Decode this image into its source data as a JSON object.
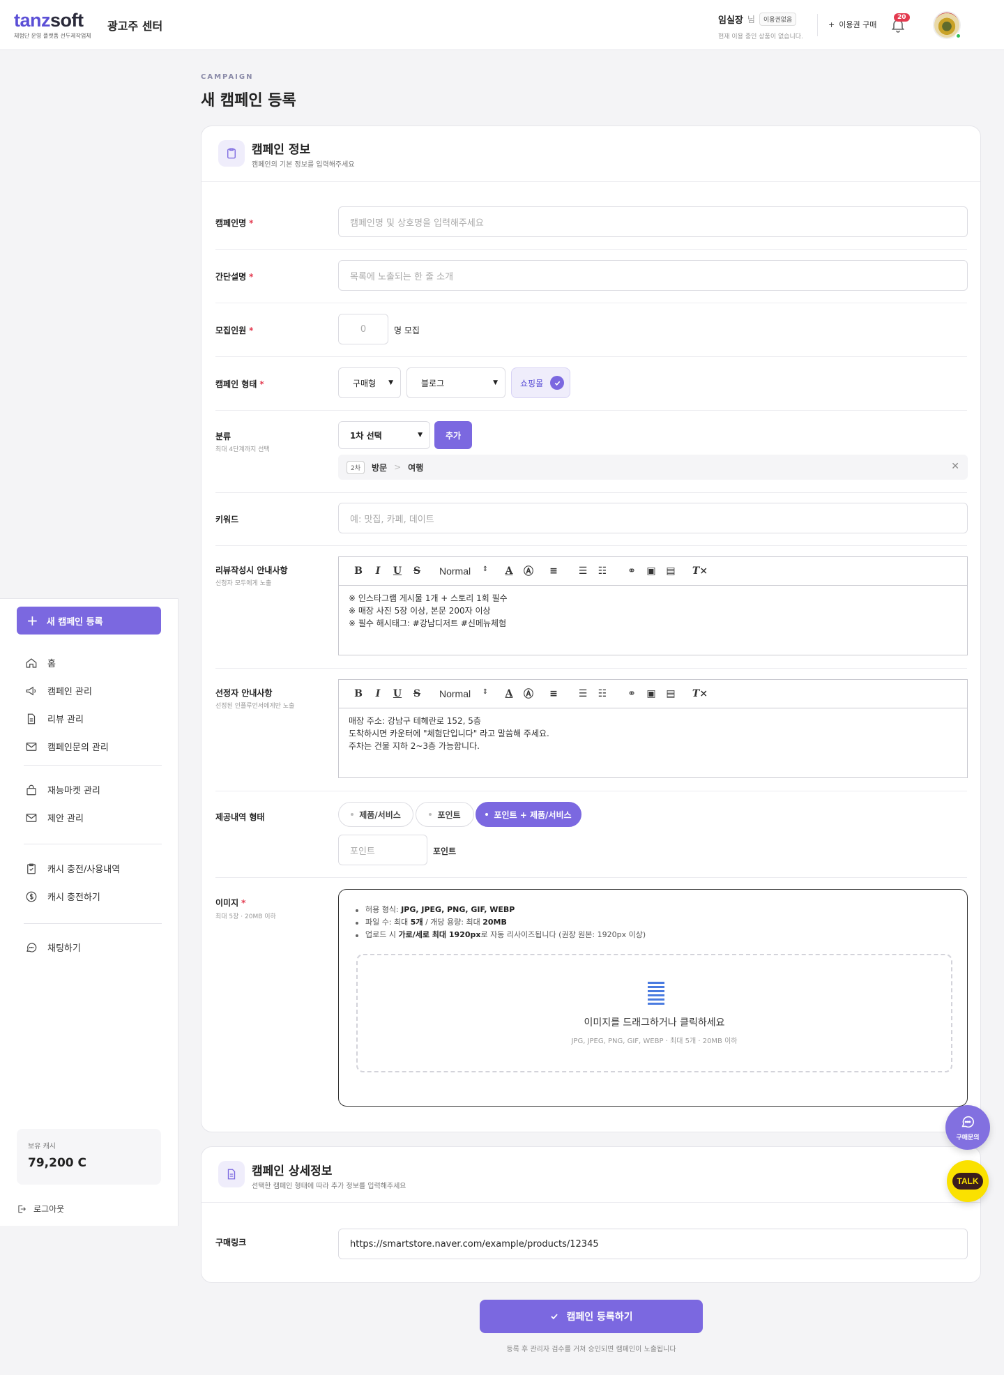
{
  "brand": {
    "logo_main": "tanz",
    "logo_accent": "soft",
    "tagline": "체험단 운영 플랫폼 선두제작업체",
    "center": "광고주 센터"
  },
  "user": {
    "name": "임실장",
    "suffix": "님",
    "plan_badge": "이용권없음",
    "status": "현재 이용 중인 상품이 없습니다.",
    "buy_pass": "이용권 구매",
    "notifications": "20"
  },
  "sidebar": {
    "new_campaign": "새 캠페인 등록",
    "group1": [
      "홈",
      "캠페인 관리",
      "리뷰 관리",
      "캠페인문의 관리"
    ],
    "group2": [
      "재능마켓 관리",
      "제안 관리"
    ],
    "group3": [
      "캐시 충전/사용내역",
      "캐시 충전하기"
    ],
    "group4": [
      "채팅하기"
    ],
    "cash_label": "보유 캐시",
    "cash_value": "79,200 C",
    "logout": "로그아웃"
  },
  "page": {
    "kicker": "CAMPAIGN",
    "title": "새 캠페인 등록"
  },
  "info_card": {
    "title": "캠페인 정보",
    "subtitle": "캠페인의 기본 정보를 입력해주세요",
    "name_label": "캠페인명",
    "name_placeholder": "캠페인명 및 상호명을 입력해주세요",
    "desc_label": "간단설명",
    "desc_placeholder": "목록에 노출되는 한 줄 소개",
    "recruit_label": "모집인원",
    "recruit_placeholder": "0",
    "recruit_suffix": "명 모집",
    "type_label": "캠페인 형태",
    "type_select1": "구매형",
    "type_select2": "블로그",
    "type_chip": "쇼핑몰",
    "category_label": "분류",
    "category_hint": "최대 4단계까지 선택",
    "category_select": "1차 선택",
    "category_add": "추가",
    "category_level": "2차",
    "category_path1": "방문",
    "category_path2": "여행",
    "keyword_label": "키워드",
    "keyword_placeholder": "예: 맛집, 카페, 데이트",
    "review_label": "리뷰작성시 안내사항",
    "review_hint": "신청자 모두에게 노출",
    "review_lines": [
      "※ 인스타그램 게시물 1개 + 스토리 1회 필수",
      "※ 매장 사진 5장 이상, 본문 200자 이상",
      "※ 필수 해시태그: #강남디저트 #신메뉴체험"
    ],
    "selected_label": "선정자 안내사항",
    "selected_hint": "선정된 인플루언서에게만 노출",
    "selected_lines": [
      "매장 주소: 강남구 테헤란로 152, 5층",
      "도착하시면 카운터에 \"체험단입니다\" 라고 말씀해 주세요.",
      "주차는 건물 지하 2~3층 가능합니다."
    ],
    "toolbar_format": "Normal",
    "offer_label": "제공내역 형태",
    "offer_options": [
      "제품/서비스",
      "포인트",
      "포인트 + 제품/서비스"
    ],
    "point_placeholder": "포인트",
    "point_suffix": "포인트",
    "image_label": "이미지",
    "image_hint": "최대 5장 · 20MB 이하",
    "rule1_prefix": "허용 형식: ",
    "rule1_value": "JPG, JPEG, PNG, GIF, WEBP",
    "rule2_prefix": "파일 수: 최대 ",
    "rule2_count": "5개",
    "rule2_mid": " / 개당 용량: 최대 ",
    "rule2_size": "20MB",
    "rule3_prefix": "업로드 시 ",
    "rule3_bold": "가로/세로 최대 1920px",
    "rule3_suffix": "로 자동 리사이즈됩니다 (권장 원본: 1920px 이상)",
    "drop_title": "이미지를 드래그하거나 클릭하세요",
    "drop_sub": "JPG, JPEG, PNG, GIF, WEBP · 최대 5개 · 20MB 이하"
  },
  "detail_card": {
    "title": "캠페인 상세정보",
    "subtitle": "선택한 캠페인 형태에 따라 추가 정보를 입력해주세요",
    "link_label": "구매링크",
    "link_value": "https://smartstore.naver.com/example/products/12345"
  },
  "submit": {
    "label": "캠페인 등록하기",
    "note": "등록 후 관리자 검수를 거쳐 승인되면 캠페인이 노출됩니다"
  },
  "floating": {
    "chat_label": "구매문의",
    "talk_label": "TALK"
  },
  "colors": {
    "accent": "#7b68e0",
    "danger": "#e33a4f",
    "kakao": "#fae100"
  }
}
